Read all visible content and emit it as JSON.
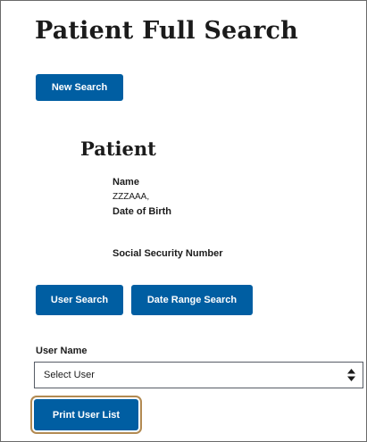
{
  "page": {
    "title": "Patient Full Search"
  },
  "toolbar": {
    "new_search_label": "New Search"
  },
  "patient": {
    "section_title": "Patient",
    "name_label": "Name",
    "name_value": "ZZZAAA,",
    "dob_label": "Date of Birth",
    "ssn_label": "Social Security Number"
  },
  "search_buttons": {
    "user_search_label": "User Search",
    "date_range_search_label": "Date Range Search"
  },
  "user_filter": {
    "label": "User Name",
    "selected": "Select User",
    "icon": "select-sort-arrows-icon"
  },
  "actions": {
    "print_user_list_label": "Print User List"
  },
  "colors": {
    "primary_button": "#005ea2",
    "focus_ring": "#b28a52",
    "frame_border": "#6b6b6b"
  }
}
